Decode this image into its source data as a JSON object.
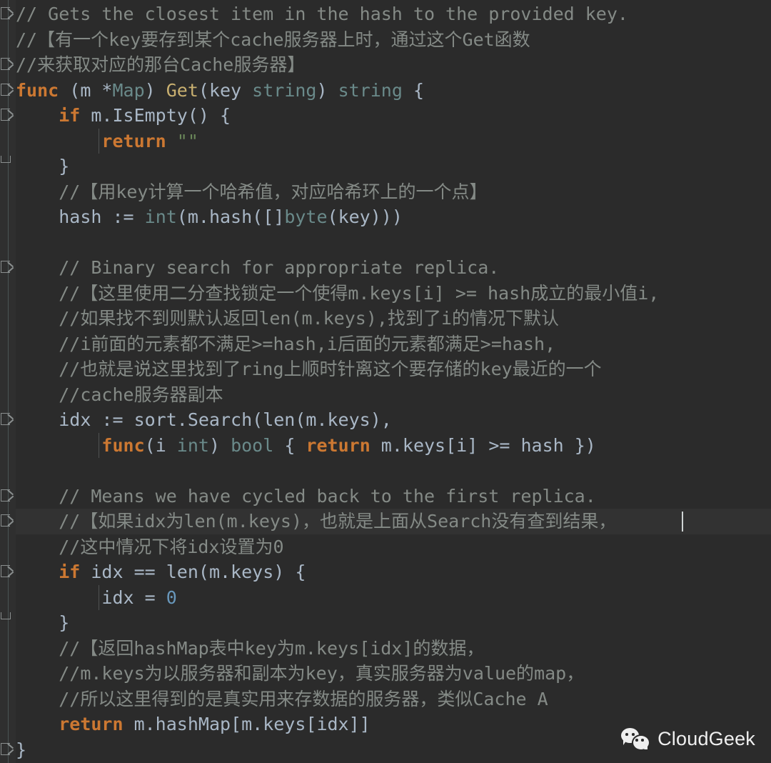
{
  "editor": {
    "language": "Go",
    "theme_colors": {
      "background": "#2b2b2b",
      "gutter_background": "#2f2f2f",
      "current_line_background": "#323232",
      "default_text": "#a9b7c6",
      "comment": "#848a86",
      "keyword": "#cc7832",
      "function_name": "#c9b070",
      "type": "#6a8a8a",
      "string": "#6a8759",
      "number": "#6897bb",
      "caret": "#cfd4d4",
      "fold_marker": "#8a8f8f"
    },
    "caret": {
      "line_index": 20,
      "column_after_text": "//这中情况下将idx设置为0"
    },
    "current_line_index": 20,
    "lines": [
      {
        "indent": 0,
        "tokens": [
          {
            "t": "cmt",
            "s": "// Gets the closest item in the hash to the provided key."
          }
        ]
      },
      {
        "indent": 0,
        "tokens": [
          {
            "t": "cmt",
            "s": "//【有一个key要存到某个cache服务器上时，通过这个Get函数"
          }
        ]
      },
      {
        "indent": 0,
        "tokens": [
          {
            "t": "cmt",
            "s": "//来获取对应的那台Cache服务器】"
          }
        ]
      },
      {
        "indent": 0,
        "tokens": [
          {
            "t": "kw",
            "s": "func"
          },
          {
            "t": "pln",
            "s": " (m *"
          },
          {
            "t": "typ",
            "s": "Map"
          },
          {
            "t": "pln",
            "s": ") "
          },
          {
            "t": "fn",
            "s": "Get"
          },
          {
            "t": "pln",
            "s": "(key "
          },
          {
            "t": "typ",
            "s": "string"
          },
          {
            "t": "pln",
            "s": ") "
          },
          {
            "t": "typ",
            "s": "string"
          },
          {
            "t": "pln",
            "s": " {"
          }
        ]
      },
      {
        "indent": 1,
        "tokens": [
          {
            "t": "kw",
            "s": "if"
          },
          {
            "t": "pln",
            "s": " m.IsEmpty() {"
          }
        ]
      },
      {
        "indent": 2,
        "tokens": [
          {
            "t": "kw",
            "s": "return"
          },
          {
            "t": "pln",
            "s": " "
          },
          {
            "t": "str",
            "s": "\"\""
          }
        ]
      },
      {
        "indent": 1,
        "tokens": [
          {
            "t": "pln",
            "s": "}"
          }
        ]
      },
      {
        "indent": 1,
        "tokens": [
          {
            "t": "cmt",
            "s": "//【用key计算一个哈希值，对应哈希环上的一个点】"
          }
        ]
      },
      {
        "indent": 1,
        "tokens": [
          {
            "t": "pln",
            "s": "hash := "
          },
          {
            "t": "typ",
            "s": "int"
          },
          {
            "t": "pln",
            "s": "(m.hash([]"
          },
          {
            "t": "typ",
            "s": "byte"
          },
          {
            "t": "pln",
            "s": "(key)))"
          }
        ]
      },
      {
        "indent": 0,
        "tokens": []
      },
      {
        "indent": 1,
        "tokens": [
          {
            "t": "cmt",
            "s": "// Binary search for appropriate replica."
          }
        ]
      },
      {
        "indent": 1,
        "tokens": [
          {
            "t": "cmt",
            "s": "//【这里使用二分查找锁定一个使得m.keys[i] >= hash成立的最小值i,"
          }
        ]
      },
      {
        "indent": 1,
        "tokens": [
          {
            "t": "cmt",
            "s": "//如果找不到则默认返回len(m.keys),找到了i的情况下默认"
          }
        ]
      },
      {
        "indent": 1,
        "tokens": [
          {
            "t": "cmt",
            "s": "//i前面的元素都不满足>=hash,i后面的元素都满足>=hash,"
          }
        ]
      },
      {
        "indent": 1,
        "tokens": [
          {
            "t": "cmt",
            "s": "//也就是说这里找到了ring上顺时针离这个要存储的key最近的一个"
          }
        ]
      },
      {
        "indent": 1,
        "tokens": [
          {
            "t": "cmt",
            "s": "//cache服务器副本"
          }
        ]
      },
      {
        "indent": 1,
        "tokens": [
          {
            "t": "pln",
            "s": "idx := sort.Search(len(m.keys),"
          }
        ]
      },
      {
        "indent": 2,
        "tokens": [
          {
            "t": "kw",
            "s": "func"
          },
          {
            "t": "pln",
            "s": "(i "
          },
          {
            "t": "typ",
            "s": "int"
          },
          {
            "t": "pln",
            "s": ") "
          },
          {
            "t": "typ",
            "s": "bool"
          },
          {
            "t": "pln",
            "s": " { "
          },
          {
            "t": "kw",
            "s": "return"
          },
          {
            "t": "pln",
            "s": " m.keys[i] >= hash })"
          }
        ]
      },
      {
        "indent": 0,
        "tokens": []
      },
      {
        "indent": 1,
        "tokens": [
          {
            "t": "cmt",
            "s": "// Means we have cycled back to the first replica."
          }
        ]
      },
      {
        "indent": 1,
        "tokens": [
          {
            "t": "cmt",
            "s": "//【如果idx为len(m.keys)，也就是上面从Search没有查到结果，"
          }
        ]
      },
      {
        "indent": 1,
        "tokens": [
          {
            "t": "cmt",
            "s": "//这中情况下将idx设置为0"
          }
        ]
      },
      {
        "indent": 1,
        "tokens": [
          {
            "t": "kw",
            "s": "if"
          },
          {
            "t": "pln",
            "s": " idx == len(m.keys) {"
          }
        ]
      },
      {
        "indent": 2,
        "tokens": [
          {
            "t": "pln",
            "s": "idx = "
          },
          {
            "t": "num",
            "s": "0"
          }
        ]
      },
      {
        "indent": 1,
        "tokens": [
          {
            "t": "pln",
            "s": "}"
          }
        ]
      },
      {
        "indent": 1,
        "tokens": [
          {
            "t": "cmt",
            "s": "//【返回hashMap表中key为m.keys[idx]的数据，"
          }
        ]
      },
      {
        "indent": 1,
        "tokens": [
          {
            "t": "cmt",
            "s": "//m.keys为以服务器和副本为key，真实服务器为value的map，"
          }
        ]
      },
      {
        "indent": 1,
        "tokens": [
          {
            "t": "cmt",
            "s": "//所以这里得到的是真实用来存数据的服务器，类似Cache A"
          }
        ]
      },
      {
        "indent": 1,
        "tokens": [
          {
            "t": "kw",
            "s": "return"
          },
          {
            "t": "pln",
            "s": " m.hashMap[m.keys[idx]]"
          }
        ]
      },
      {
        "indent": 0,
        "tokens": [
          {
            "t": "pln",
            "s": "}"
          }
        ]
      }
    ],
    "fold_markers": [
      {
        "line_index": 0,
        "kind": "expanded"
      },
      {
        "line_index": 2,
        "kind": "expanded"
      },
      {
        "line_index": 3,
        "kind": "expanded"
      },
      {
        "line_index": 4,
        "kind": "expanded"
      },
      {
        "line_index": 6,
        "kind": "end"
      },
      {
        "line_index": 10,
        "kind": "expanded"
      },
      {
        "line_index": 16,
        "kind": "expanded"
      },
      {
        "line_index": 19,
        "kind": "expanded"
      },
      {
        "line_index": 20,
        "kind": "expanded"
      },
      {
        "line_index": 22,
        "kind": "expanded"
      },
      {
        "line_index": 24,
        "kind": "end"
      },
      {
        "line_index": 29,
        "kind": "expanded"
      }
    ],
    "indent_guides": [
      {
        "line_start": 5,
        "line_end": 5,
        "indent": 2
      },
      {
        "line_start": 17,
        "line_end": 17,
        "indent": 2
      },
      {
        "line_start": 23,
        "line_end": 23,
        "indent": 2
      }
    ]
  },
  "watermark": {
    "icon": "wechat-icon",
    "label": "CloudGeek"
  }
}
